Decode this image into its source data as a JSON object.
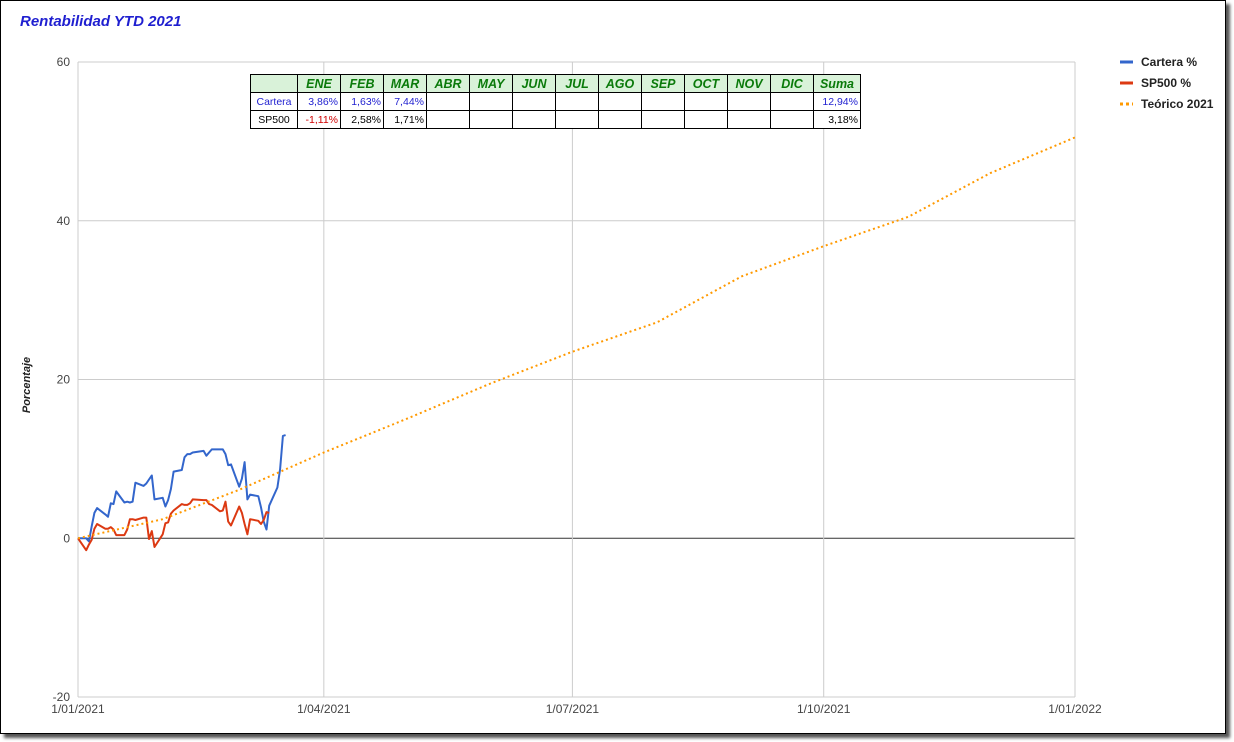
{
  "chart_data": {
    "type": "line",
    "title": "Rentabilidad YTD 2021",
    "xlabel": "",
    "ylabel": "Porcentaje",
    "xlim": [
      "2021-01-01",
      "2022-01-01"
    ],
    "ylim": [
      -20,
      60
    ],
    "y_ticks": [
      "60",
      "40",
      "20",
      "0",
      "-20"
    ],
    "x_ticks": [
      "1/01/2021",
      "1/04/2021",
      "1/07/2021",
      "1/10/2021",
      "1/01/2022"
    ],
    "grid": true,
    "legend_position": "right",
    "series": [
      {
        "name": "Cartera %",
        "color": "#3366cc",
        "style": "solid",
        "points": [
          [
            "2021-01-01",
            0
          ],
          [
            "2021-01-04",
            0
          ],
          [
            "2021-01-05",
            -0.4
          ],
          [
            "2021-01-06",
            1.5
          ],
          [
            "2021-01-07",
            3.2
          ],
          [
            "2021-01-08",
            3.8
          ],
          [
            "2021-01-11",
            3.0
          ],
          [
            "2021-01-12",
            2.7
          ],
          [
            "2021-01-13",
            4.4
          ],
          [
            "2021-01-14",
            4.3
          ],
          [
            "2021-01-15",
            5.9
          ],
          [
            "2021-01-18",
            4.5
          ],
          [
            "2021-01-19",
            4.6
          ],
          [
            "2021-01-20",
            4.5
          ],
          [
            "2021-01-21",
            4.6
          ],
          [
            "2021-01-22",
            7.0
          ],
          [
            "2021-01-25",
            6.6
          ],
          [
            "2021-01-26",
            6.9
          ],
          [
            "2021-01-27",
            7.4
          ],
          [
            "2021-01-28",
            7.9
          ],
          [
            "2021-01-29",
            4.9
          ],
          [
            "2021-02-01",
            5.1
          ],
          [
            "2021-02-02",
            4.0
          ],
          [
            "2021-02-03",
            4.8
          ],
          [
            "2021-02-04",
            6.2
          ],
          [
            "2021-02-05",
            8.4
          ],
          [
            "2021-02-08",
            8.6
          ],
          [
            "2021-02-09",
            10.2
          ],
          [
            "2021-02-10",
            10.6
          ],
          [
            "2021-02-11",
            10.6
          ],
          [
            "2021-02-12",
            10.8
          ],
          [
            "2021-02-16",
            11.0
          ],
          [
            "2021-02-17",
            10.4
          ],
          [
            "2021-02-18",
            10.8
          ],
          [
            "2021-02-19",
            11.2
          ],
          [
            "2021-02-22",
            11.2
          ],
          [
            "2021-02-23",
            11.2
          ],
          [
            "2021-02-24",
            10.6
          ],
          [
            "2021-02-25",
            9.2
          ],
          [
            "2021-02-26",
            9.3
          ],
          [
            "2021-03-01",
            6.5
          ],
          [
            "2021-03-02",
            7.5
          ],
          [
            "2021-03-03",
            9.6
          ],
          [
            "2021-03-04",
            4.9
          ],
          [
            "2021-03-05",
            5.5
          ],
          [
            "2021-03-08",
            5.3
          ],
          [
            "2021-03-09",
            3.9
          ],
          [
            "2021-03-10",
            2.1
          ],
          [
            "2021-03-11",
            1.1
          ],
          [
            "2021-03-12",
            4.1
          ],
          [
            "2021-03-15",
            6.4
          ],
          [
            "2021-03-16",
            8.7
          ],
          [
            "2021-03-17",
            12.9
          ],
          [
            "2021-03-18",
            13.0
          ]
        ]
      },
      {
        "name": "SP500 %",
        "color": "#dc3912",
        "style": "solid",
        "points": [
          [
            "2021-01-01",
            0
          ],
          [
            "2021-01-04",
            -1.5
          ],
          [
            "2021-01-05",
            -0.8
          ],
          [
            "2021-01-06",
            -0.2
          ],
          [
            "2021-01-07",
            1.2
          ],
          [
            "2021-01-08",
            1.8
          ],
          [
            "2021-01-11",
            1.2
          ],
          [
            "2021-01-12",
            1.2
          ],
          [
            "2021-01-13",
            1.4
          ],
          [
            "2021-01-14",
            1.1
          ],
          [
            "2021-01-15",
            0.4
          ],
          [
            "2021-01-18",
            0.4
          ],
          [
            "2021-01-19",
            1.1
          ],
          [
            "2021-01-20",
            2.4
          ],
          [
            "2021-01-21",
            2.4
          ],
          [
            "2021-01-22",
            2.3
          ],
          [
            "2021-01-25",
            2.6
          ],
          [
            "2021-01-26",
            2.6
          ],
          [
            "2021-01-27",
            -0.1
          ],
          [
            "2021-01-28",
            0.9
          ],
          [
            "2021-01-29",
            -1.1
          ],
          [
            "2021-02-01",
            0.5
          ],
          [
            "2021-02-02",
            1.9
          ],
          [
            "2021-02-03",
            2.0
          ],
          [
            "2021-02-04",
            3.1
          ],
          [
            "2021-02-05",
            3.5
          ],
          [
            "2021-02-08",
            4.3
          ],
          [
            "2021-02-09",
            4.2
          ],
          [
            "2021-02-10",
            4.2
          ],
          [
            "2021-02-11",
            4.4
          ],
          [
            "2021-02-12",
            4.9
          ],
          [
            "2021-02-16",
            4.8
          ],
          [
            "2021-02-17",
            4.8
          ],
          [
            "2021-02-18",
            4.3
          ],
          [
            "2021-02-19",
            4.2
          ],
          [
            "2021-02-22",
            3.4
          ],
          [
            "2021-02-23",
            3.5
          ],
          [
            "2021-02-24",
            4.6
          ],
          [
            "2021-02-25",
            2.1
          ],
          [
            "2021-02-26",
            1.6
          ],
          [
            "2021-03-01",
            4.0
          ],
          [
            "2021-03-02",
            3.2
          ],
          [
            "2021-03-03",
            1.8
          ],
          [
            "2021-03-04",
            0.5
          ],
          [
            "2021-03-05",
            2.4
          ],
          [
            "2021-03-08",
            2.2
          ],
          [
            "2021-03-09",
            1.8
          ],
          [
            "2021-03-10",
            2.3
          ],
          [
            "2021-03-11",
            3.3
          ],
          [
            "2021-03-12",
            3.2
          ]
        ]
      },
      {
        "name": "Teórico 2021",
        "color": "#ff9900",
        "style": "dotted",
        "points": [
          [
            "2021-01-01",
            0
          ],
          [
            "2021-02-01",
            2.4
          ],
          [
            "2021-03-01",
            6.1
          ],
          [
            "2021-04-01",
            10.8
          ],
          [
            "2021-05-01",
            15.0
          ],
          [
            "2021-06-01",
            19.5
          ],
          [
            "2021-07-01",
            23.5
          ],
          [
            "2021-08-01",
            27.2
          ],
          [
            "2021-09-01",
            33.0
          ],
          [
            "2021-10-01",
            36.8
          ],
          [
            "2021-11-01",
            40.5
          ],
          [
            "2021-12-01",
            46.0
          ],
          [
            "2022-01-01",
            50.5
          ]
        ]
      }
    ]
  },
  "table": {
    "headers": [
      "",
      "ENE",
      "FEB",
      "MAR",
      "ABR",
      "MAY",
      "JUN",
      "JUL",
      "AGO",
      "SEP",
      "OCT",
      "NOV",
      "DIC",
      "Suma"
    ],
    "rows": [
      {
        "label": "Cartera",
        "values": [
          "3,86%",
          "1,63%",
          "7,44%",
          "",
          "",
          "",
          "",
          "",
          "",
          "",
          "",
          "",
          "12,94%"
        ]
      },
      {
        "label": "SP500",
        "values": [
          "-1,11%",
          "2,58%",
          "1,71%",
          "",
          "",
          "",
          "",
          "",
          "",
          "",
          "",
          "",
          "3,18%"
        ]
      }
    ]
  }
}
